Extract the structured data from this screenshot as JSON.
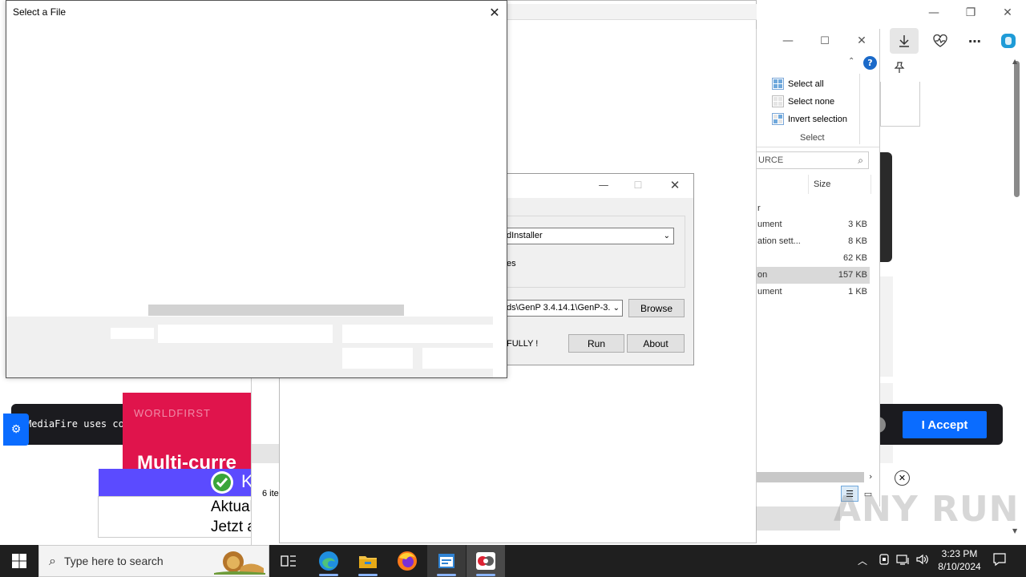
{
  "browser": {
    "window_controls": {
      "minimize": "—",
      "restore": "❐",
      "close": "✕"
    },
    "toolbar_icons": [
      "download-icon",
      "heart-pulse-icon",
      "more-icon",
      "copilot-icon"
    ]
  },
  "page": {
    "cookie_text": "MediaFire uses cookies to provide you with a pers",
    "accept_label": "I Accept",
    "ad_heading": "Multi-curre",
    "ad_blue_text": "K",
    "ad_line1": "Aktualisie",
    "ad_line2": "Jetzt aktu",
    "ad_top_text": "WORLDFIRST"
  },
  "explorer": {
    "select_group": {
      "items": [
        "Select all",
        "Select none",
        "Invert selection"
      ],
      "label": "Select"
    },
    "search_text": "URCE",
    "column_size": "Size",
    "rows": [
      {
        "name": "r",
        "size": ""
      },
      {
        "name": "ument",
        "size": "3 KB"
      },
      {
        "name": "ation sett...",
        "size": "8 KB"
      },
      {
        "name": "",
        "size": "62 KB"
      },
      {
        "name": "on",
        "size": "157 KB"
      },
      {
        "name": "ument",
        "size": "1 KB"
      }
    ],
    "status_left": "6 ite"
  },
  "genp": {
    "select_value": "dInstaller",
    "checkbox_text": "es",
    "path_value": "ds\\GenP 3.4.14.1\\GenP-3.",
    "browse_label": "Browse",
    "status_text": "FULLY !",
    "run_label": "Run",
    "about_label": "About"
  },
  "file_dialog": {
    "title": "Select a File",
    "close": "✕"
  },
  "taskbar": {
    "search_placeholder": "Type here to search",
    "time": "3:23 PM",
    "date": "8/10/2024"
  },
  "watermark": "ANY RUN"
}
